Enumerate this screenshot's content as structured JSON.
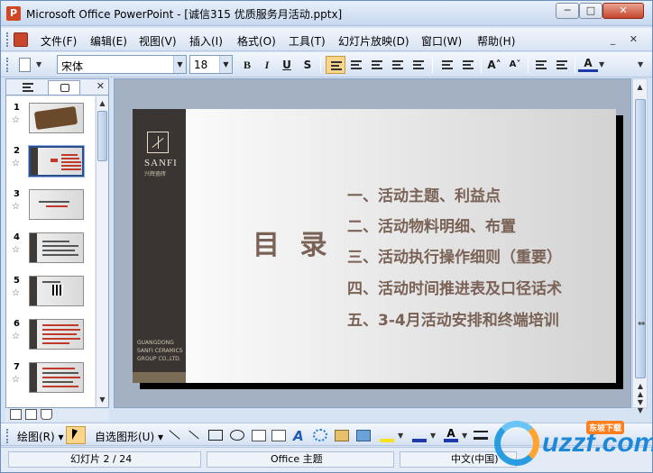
{
  "window": {
    "title": "Microsoft Office PowerPoint - [诚信315 优质服务月活动.pptx]",
    "app_icon_letter": "P",
    "min_symbol": "─",
    "max_symbol": "□",
    "close_symbol": "✕"
  },
  "menu": {
    "items": [
      "文件(F)",
      "编辑(E)",
      "视图(V)",
      "插入(I)",
      "格式(O)",
      "工具(T)",
      "幻灯片放映(D)",
      "窗口(W)",
      "帮助(H)"
    ],
    "doc_controls": "_ ✕"
  },
  "toolbar": {
    "font_name": "宋体",
    "font_size": "18",
    "bold": "B",
    "italic": "I",
    "underline": "U",
    "shadow": "S",
    "grow_font": "A˄",
    "shrink_font": "A˅",
    "font_color": "A"
  },
  "slide_panel": {
    "tab_outline_icon": "outline-icon",
    "tab_slides_icon": "slides-icon",
    "close_symbol": "✕",
    "slides": [
      {
        "num": "1",
        "star": "☆"
      },
      {
        "num": "2",
        "star": "☆"
      },
      {
        "num": "3",
        "star": "☆"
      },
      {
        "num": "4",
        "star": "☆"
      },
      {
        "num": "5",
        "star": "☆"
      },
      {
        "num": "6",
        "star": "☆"
      },
      {
        "num": "7",
        "star": "☆"
      }
    ],
    "selected_index": 1
  },
  "slide": {
    "logo_text": "SANFI",
    "logo_sub": "兴辉瓷砖",
    "footer_lines": [
      "GUANGDONG",
      "SANFI CERAMICS",
      "GROUP CO.,LTD."
    ],
    "title": "目 录",
    "toc": [
      "一、活动主题、利益点",
      "二、活动物料明细、布置",
      "三、活动执行操作细则（重要）",
      "四、活动时间推进表及口径话术",
      "五、3-4月活动安排和终端培训"
    ]
  },
  "drawing_toolbar": {
    "draw_label": "绘图(R) ▾",
    "autoshapes_label": "自选图形(U) ▾"
  },
  "status": {
    "slide_info": "幻灯片 2 / 24",
    "theme": "Office 主题",
    "language": "中文(中国)"
  },
  "watermark": {
    "text": "uzzf.com",
    "badge": "东坡下载"
  }
}
